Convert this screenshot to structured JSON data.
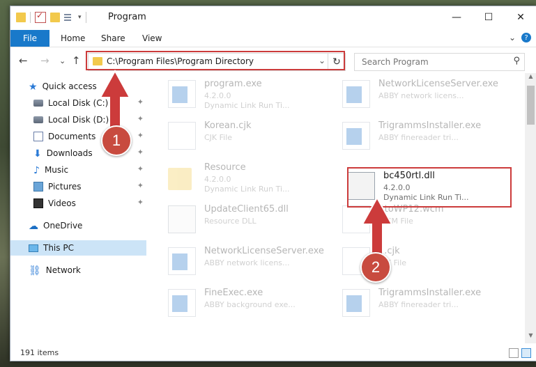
{
  "window": {
    "title": "Program",
    "controls": {
      "minimize": "—",
      "maximize": "☐",
      "close": "✕"
    }
  },
  "ribbon": {
    "tabs": [
      "File",
      "Home",
      "Share",
      "View"
    ],
    "expand": "⌄",
    "help": "?"
  },
  "nav": {
    "back": "←",
    "forward": "→",
    "recent": "⌄",
    "up": "↑",
    "address": "C:\\Program Files\\Program Directory",
    "address_dropdown": "⌄",
    "refresh": "↻",
    "search_placeholder": "Search Program",
    "search_icon": "⚲"
  },
  "sidebar": {
    "items": [
      {
        "label": "Quick access",
        "icon": "star-icon",
        "pinned": false
      },
      {
        "label": "Local Disk (C:)",
        "icon": "disk-icon",
        "pinned": true
      },
      {
        "label": "Local Disk (D:)",
        "icon": "disk-icon",
        "pinned": true
      },
      {
        "label": "Documents",
        "icon": "document-icon",
        "pinned": true
      },
      {
        "label": "Downloads",
        "icon": "download-icon",
        "pinned": true
      },
      {
        "label": "Music",
        "icon": "music-icon",
        "pinned": true
      },
      {
        "label": "Pictures",
        "icon": "picture-icon",
        "pinned": true
      },
      {
        "label": "Videos",
        "icon": "video-icon",
        "pinned": true
      },
      {
        "label": "OneDrive",
        "icon": "cloud-icon",
        "pinned": false
      },
      {
        "label": "This PC",
        "icon": "pc-icon",
        "pinned": false,
        "selected": true
      },
      {
        "label": "Network",
        "icon": "network-icon",
        "pinned": false
      }
    ],
    "pin_glyph": "📌"
  },
  "files": [
    {
      "name": "program.exe",
      "line1": "4.2.0.0",
      "line2": "Dynamic Link Run Ti...",
      "icon": "exe-icon"
    },
    {
      "name": "NetworkLicenseServer.exe",
      "line1": "ABBY network licens...",
      "line2": "",
      "icon": "exe-icon"
    },
    {
      "name": "Korean.cjk",
      "line1": "CJK File",
      "line2": "",
      "icon": "document-icon"
    },
    {
      "name": "TrigrammsInstaller.exe",
      "line1": "ABBY finereader tri...",
      "line2": "",
      "icon": "exe-icon"
    },
    {
      "name": "Resource",
      "line1": "4.2.0.0",
      "line2": "Dynamic Link Run Ti...",
      "icon": "folder-icon"
    },
    {
      "name": "bc450rtl.dll",
      "line1": "4.2.0.0",
      "line2": "Dynamic Link Run Ti...",
      "icon": "gear-icon",
      "highlighted": true
    },
    {
      "name": "UpdateClient65.dll",
      "line1": "Resource DLL",
      "line2": "",
      "icon": "gear-icon"
    },
    {
      "name": "AtoWP12.wcm",
      "line1": "WCM File",
      "line2": "",
      "icon": "document-icon"
    },
    {
      "name": "NetworkLicenseServer.exe",
      "line1": "ABBY network licens...",
      "line2": "",
      "icon": "exe-icon"
    },
    {
      "name": "1.cjk",
      "line1": "CJK File",
      "line2": "",
      "icon": "document-icon"
    },
    {
      "name": "FineExec.exe",
      "line1": "ABBY background exe...",
      "line2": "",
      "icon": "exe-icon"
    },
    {
      "name": "TrigrammsInstaller.exe",
      "line1": "ABBY finereader tri...",
      "line2": "",
      "icon": "exe-icon"
    }
  ],
  "status": {
    "item_count": "191 items"
  },
  "annotations": {
    "step1": "1",
    "step2": "2",
    "color": "#cc3b3b"
  }
}
